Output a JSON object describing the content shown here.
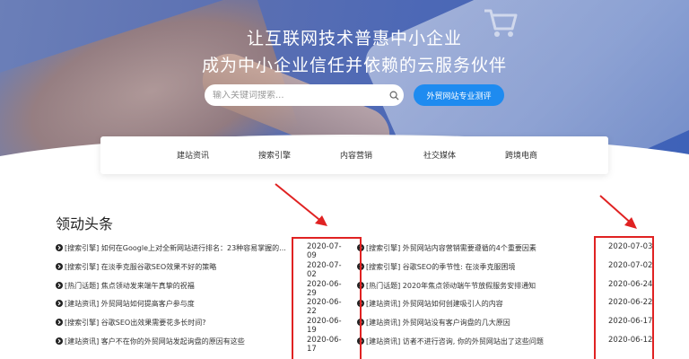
{
  "hero": {
    "title_line1": "让互联网技术普惠中小企业",
    "title_line2": "成为中小企业信任并依赖的云服务伙伴",
    "search_placeholder": "输入关键词搜索...",
    "cta_label": "外贸网站专业测评"
  },
  "nav": {
    "items": [
      {
        "label": "建站资讯"
      },
      {
        "label": "搜索引擎"
      },
      {
        "label": "内容营销"
      },
      {
        "label": "社交媒体"
      },
      {
        "label": "跨境电商"
      }
    ]
  },
  "headlines": {
    "title": "领动头条",
    "left": [
      {
        "text": "[搜索引擎] 如何在Google上对全新网站进行排名：23种容易掌握的...",
        "date": "2020-07-09"
      },
      {
        "text": "[搜索引擎] 在淡季克服谷歌SEO效果不好的策略",
        "date": "2020-07-02"
      },
      {
        "text": "[热门话题] 焦点领动发来端午真挚的祝福",
        "date": "2020-06-29"
      },
      {
        "text": "[建站资讯] 外贸网站如何提高客户参与度",
        "date": "2020-06-22"
      },
      {
        "text": "[搜索引擎] 谷歌SEO出效果需要花多长时间?",
        "date": "2020-06-19"
      },
      {
        "text": "[建站资讯] 客户不在你的外贸网站发起询盘的原因有这些",
        "date": "2020-06-17"
      }
    ],
    "right": [
      {
        "text": "[搜索引擎] 外贸网站内容营销需要遵循的4个重要因素",
        "date": "2020-07-03"
      },
      {
        "text": "[搜索引擎] 谷歌SEO的季节性: 在淡季克服困境",
        "date": "2020-07-02"
      },
      {
        "text": "[热门话题] 2020年焦点领动端午节放假服务安排通知",
        "date": "2020-06-24"
      },
      {
        "text": "[建站资讯] 外贸网站如何创建吸引人的内容",
        "date": "2020-06-22"
      },
      {
        "text": "[建站资讯] 外贸网站没有客户询盘的几大原因",
        "date": "2020-06-17"
      },
      {
        "text": "[建站资讯] 访者不进行咨询, 你的外贸网站出了这些问题",
        "date": "2020-06-12"
      }
    ]
  },
  "colors": {
    "accent": "#1e8bf0",
    "annotation_red": "#e02222"
  }
}
